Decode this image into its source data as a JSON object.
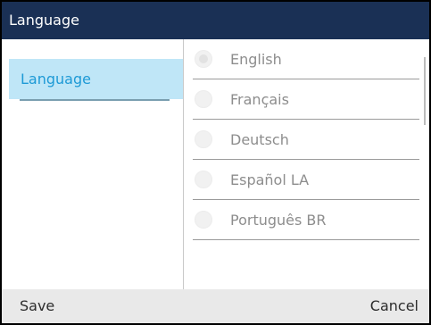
{
  "window": {
    "title": "Language"
  },
  "sidebar": {
    "items": [
      {
        "label": "Language",
        "selected": true
      }
    ]
  },
  "main": {
    "options": [
      {
        "label": "English",
        "selected": true
      },
      {
        "label": "Français",
        "selected": false
      },
      {
        "label": "Deutsch",
        "selected": false
      },
      {
        "label": "Español LA",
        "selected": false
      },
      {
        "label": "Português BR",
        "selected": false
      }
    ]
  },
  "softkeys": {
    "save_label": "Save",
    "cancel_label": "Cancel"
  },
  "colors": {
    "titlebar": "#1a3055",
    "selected_item_bg": "#bfe6f7",
    "selected_item_text": "#1e9ad6",
    "bottom_bar": "#e9e9e9"
  }
}
